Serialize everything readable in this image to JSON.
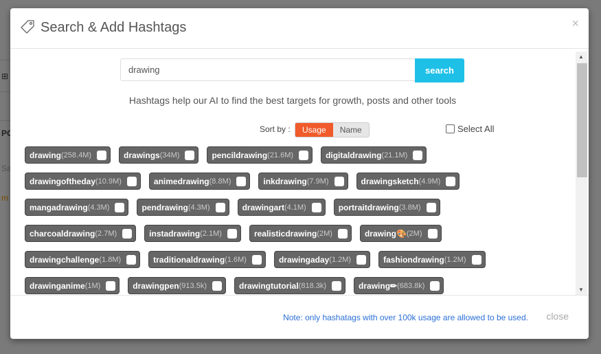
{
  "modal": {
    "title": "Search & Add Hashtags",
    "close_icon": "×"
  },
  "search": {
    "value": "drawing",
    "button": "search"
  },
  "help_text": "Hashtags help our AI to find the best targets for growth, posts and other tools",
  "sort": {
    "label": "Sort by :",
    "options": [
      "Usage",
      "Name"
    ],
    "selected": "Usage"
  },
  "select_all": "Select All",
  "background_fragments": [
    "PC",
    "Sa",
    "m"
  ],
  "tag_rows": [
    [
      {
        "name": "drawing",
        "count": "(258.4M)"
      },
      {
        "name": "drawings",
        "count": "(34M)"
      },
      {
        "name": "pencildrawing",
        "count": "(21.6M)"
      },
      {
        "name": "digitaldrawing",
        "count": "(21.1M)"
      }
    ],
    [
      {
        "name": "drawingoftheday",
        "count": "(10.9M)"
      },
      {
        "name": "animedrawing",
        "count": "(8.8M)"
      },
      {
        "name": "inkdrawing",
        "count": "(7.9M)"
      },
      {
        "name": "drawingsketch",
        "count": "(4.9M)"
      }
    ],
    [
      {
        "name": "mangadrawing",
        "count": "(4.3M)"
      },
      {
        "name": "pendrawing",
        "count": "(4.3M)"
      },
      {
        "name": "drawingart",
        "count": "(4.1M)"
      },
      {
        "name": "portraitdrawing",
        "count": "(3.8M)"
      }
    ],
    [
      {
        "name": "charcoaldrawing",
        "count": "(2.7M)"
      },
      {
        "name": "instadrawing",
        "count": "(2.1M)"
      },
      {
        "name": "realisticdrawing",
        "count": "(2M)"
      },
      {
        "name": "drawing🎨",
        "count": "(2M)"
      }
    ],
    [
      {
        "name": "drawingchallenge",
        "count": "(1.8M)"
      },
      {
        "name": "traditionaldrawing",
        "count": "(1.6M)"
      },
      {
        "name": "drawingaday",
        "count": "(1.2M)"
      },
      {
        "name": "fashiondrawing",
        "count": "(1.2M)"
      }
    ],
    [
      {
        "name": "drawinganime",
        "count": "(1M)"
      },
      {
        "name": "drawingpen",
        "count": "(913.5k)"
      },
      {
        "name": "drawingtutorial",
        "count": "(818.3k)"
      },
      {
        "name": "drawing✏",
        "count": "(683.8k)"
      }
    ]
  ],
  "footer": {
    "note": "Note: only hashatags with over 100k usage are allowed to be used.",
    "close": "close"
  },
  "colors": {
    "accent_search": "#1ec0e8",
    "sort_active": "#f15a2b",
    "tag_bg": "#666666",
    "note": "#2a6fd6"
  }
}
